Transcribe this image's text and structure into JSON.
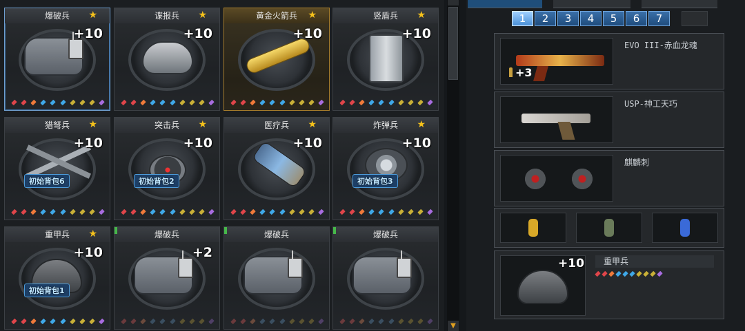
{
  "gem_colors": [
    "#e0454a",
    "#e0454a",
    "#f07a3a",
    "#3fa8e8",
    "#3fa8e8",
    "#3fa8e8",
    "#c9b037",
    "#c9b037",
    "#c9b037",
    "#a86ce0"
  ],
  "gem_colors_dim": [
    "#6b3a3c",
    "#6b3a3c",
    "#6b4a3c",
    "#3a4e60",
    "#3a4e60",
    "#3a4e60",
    "#5a5230",
    "#5a5230",
    "#5a5230",
    "#4f3f66"
  ],
  "cards": [
    {
      "title": "爆破兵",
      "plus": "+10",
      "star": "★",
      "pack": "",
      "item": "bag",
      "selected": true
    },
    {
      "title": "谍报兵",
      "plus": "+10",
      "star": "★",
      "pack": "",
      "item": "mask"
    },
    {
      "title": "黄金火箭兵",
      "plus": "+10",
      "star": "★",
      "pack": "",
      "item": "rpg",
      "gold": true
    },
    {
      "title": "竖盾兵",
      "plus": "+10",
      "star": "★",
      "pack": "",
      "item": "shield"
    },
    {
      "title": "猎弩兵",
      "plus": "+10",
      "star": "★",
      "pack": "初始背包6",
      "item": "xbow"
    },
    {
      "title": "突击兵",
      "plus": "+10",
      "star": "★",
      "pack": "初始背包2",
      "item": "sensor"
    },
    {
      "title": "医疗兵",
      "plus": "+10",
      "star": "★",
      "pack": "",
      "item": "canister"
    },
    {
      "title": "炸弹兵",
      "plus": "+10",
      "star": "★",
      "pack": "初始背包3",
      "item": "turbine"
    },
    {
      "title": "重甲兵",
      "plus": "+10",
      "star": "★",
      "pack": "初始背包1",
      "item": "helmet"
    },
    {
      "title": "爆破兵",
      "plus": "+2",
      "star": "",
      "pack": "",
      "item": "bag",
      "flag": true,
      "dim": true
    },
    {
      "title": "爆破兵",
      "plus": "",
      "star": "",
      "pack": "",
      "item": "bag",
      "flag": true,
      "dim": true
    },
    {
      "title": "爆破兵",
      "plus": "",
      "star": "",
      "pack": "",
      "item": "bag",
      "flag": true,
      "dim": true
    }
  ],
  "right": {
    "pages": [
      "1",
      "2",
      "3",
      "4",
      "5",
      "6",
      "7"
    ],
    "active_page": "1",
    "primary": {
      "name": "EVO III-赤血龙魂",
      "ammo": "+3"
    },
    "secondary": {
      "name": "USP-神工天巧"
    },
    "melee": {
      "name": "麒麟刺"
    },
    "grenades": [
      "#d8a828",
      "#6a7b5a",
      "#3a6ad8"
    ],
    "class": {
      "name": "重甲兵",
      "plus": "+10"
    }
  }
}
